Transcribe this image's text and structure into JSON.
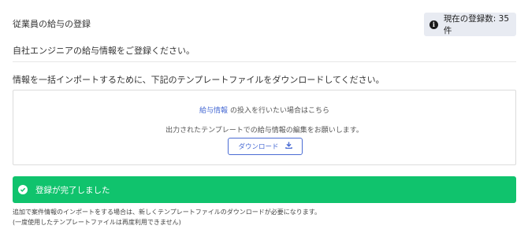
{
  "header": {
    "title": "従業員の給与の登録",
    "count_badge": "現在の登録数: 35件",
    "count_icon": "info-icon"
  },
  "subtitle": "自社エンジニアの給与情報をご登録ください。",
  "instruction": "情報を一括インポートするために、下記のテンプレートファイルをダウンロードしてください。",
  "import_box": {
    "link_text": "給与情報",
    "line1_rest": "の投入を行いたい場合はこちら",
    "line2": "出力されたテンプレートでの給与情報の編集をお願いします。",
    "download_label": "ダウンロード",
    "link_color": "#4a6cd4"
  },
  "success": {
    "message": "登録が完了しました",
    "color": "#10c36d"
  },
  "notes": {
    "line1": "追加で案件情報のインポートをする場合は、新しくテンプレートファイルのダウンロードが必要になります。",
    "line2": "(一度使用したテンプレートファイルは再度利用できません)"
  }
}
